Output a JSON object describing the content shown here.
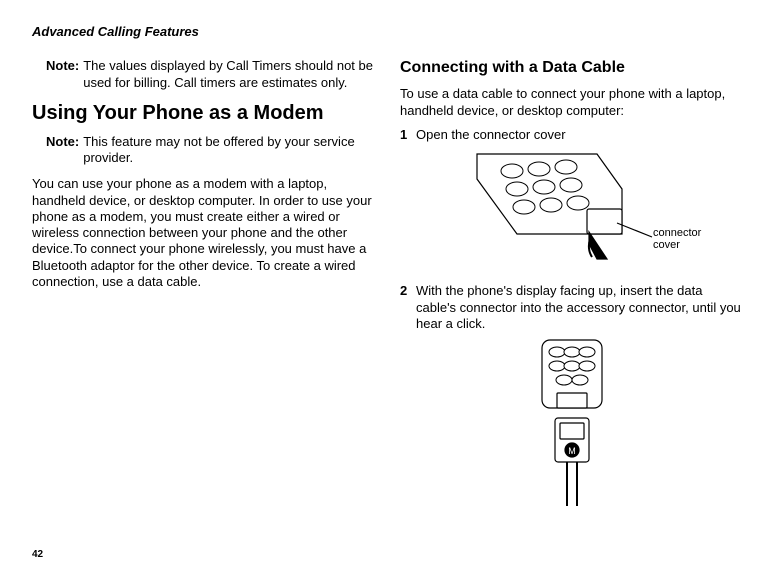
{
  "runningHeader": "Advanced Calling Features",
  "col1": {
    "note1": {
      "label": "Note:",
      "body": "The values displayed by Call Timers should not be used for billing. Call timers are estimates only."
    },
    "h1": "Using Your Phone as a Modem",
    "note2": {
      "label": "Note:",
      "body": "This feature may not be offered by your service provider."
    },
    "para": "You can use your phone as a modem with a laptop, handheld device, or desktop computer. In order to use your phone as a modem, you must create either a wired or wireless connection between your phone and the other device.To connect your phone wirelessly, you must have a Bluetooth adaptor for the other device. To create a wired connection, use a data cable."
  },
  "col2": {
    "h2": "Connecting with a Data Cable",
    "intro": "To use a data cable to connect your phone with a laptop, handheld device, or desktop computer:",
    "step1": {
      "num": "1",
      "body": "Open the connector cover"
    },
    "callout1a": "connector",
    "callout1b": "cover",
    "step2": {
      "num": "2",
      "body": "With the phone's display facing up, insert the data cable's connector into the accessory connector, until you hear a click."
    }
  },
  "pageNumber": "42"
}
